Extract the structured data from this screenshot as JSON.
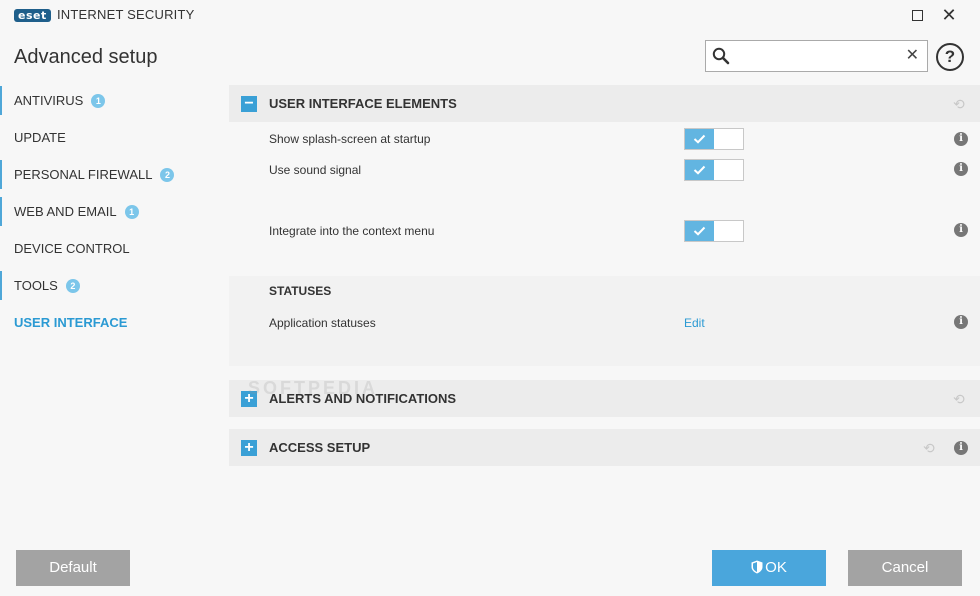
{
  "app": {
    "logo": "eset",
    "name": "INTERNET SECURITY"
  },
  "page_title": "Advanced setup",
  "search": {
    "value": "",
    "placeholder": "",
    "clear_icon": "close-icon"
  },
  "help": "?",
  "window_controls": {
    "close": "✕"
  },
  "sidebar": {
    "items": [
      {
        "label": "ANTIVIRUS",
        "badge": "1"
      },
      {
        "label": "UPDATE",
        "badge": ""
      },
      {
        "label": "PERSONAL FIREWALL",
        "badge": "2"
      },
      {
        "label": "WEB AND EMAIL",
        "badge": "1"
      },
      {
        "label": "DEVICE CONTROL",
        "badge": ""
      },
      {
        "label": "TOOLS",
        "badge": "2"
      },
      {
        "label": "USER INTERFACE",
        "badge": ""
      }
    ],
    "active_item": "USER INTERFACE"
  },
  "sections": {
    "ui_elements": {
      "title": "USER INTERFACE ELEMENTS",
      "toggle": "−",
      "settings": [
        {
          "label": "Show splash-screen at startup",
          "enabled": true
        },
        {
          "label": "Use sound signal",
          "enabled": true
        },
        {
          "label": "Integrate into the context menu",
          "enabled": true
        }
      ],
      "statuses": {
        "heading": "STATUSES",
        "label": "Application statuses",
        "action": "Edit"
      }
    },
    "alerts": {
      "title": "ALERTS AND NOTIFICATIONS",
      "toggle": "+"
    },
    "access": {
      "title": "ACCESS SETUP",
      "toggle": "+"
    }
  },
  "info_glyph": "i",
  "watermark": "SOFTPEDIA",
  "footer": {
    "default": "Default",
    "ok": "OK",
    "cancel": "Cancel"
  },
  "colors": {
    "accent": "#2b9ad3",
    "switch_on": "#62b5e1",
    "button_gray": "#a3a3a3",
    "ok_button": "#4aa6dc"
  }
}
